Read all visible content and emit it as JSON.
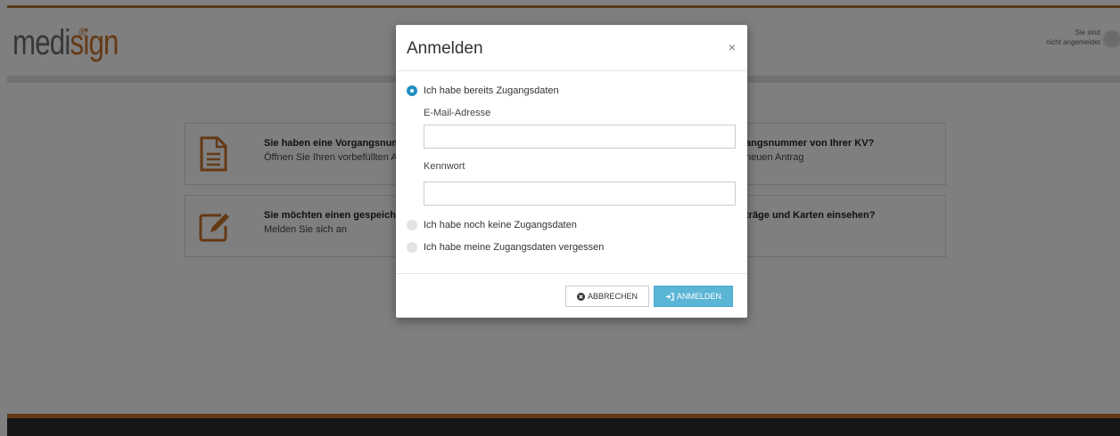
{
  "header": {
    "logo_part1": "medi",
    "logo_part2": "sign",
    "logo_reg": "®",
    "status_line1": "Sie sind",
    "status_line2": "nicht angemeldet"
  },
  "cards": [
    {
      "title": "Sie haben eine Vorgangsnum",
      "subtitle": "Öffnen Sie Ihren vorbefüllten A",
      "icon": "document-icon"
    },
    {
      "title": "angsnummer von Ihrer KV?",
      "subtitle": "neuen Antrag"
    },
    {
      "title": "Sie möchten einen gespeiche",
      "subtitle": "Melden Sie sich an",
      "icon": "edit-icon"
    },
    {
      "title": "träge und Karten einsehen?",
      "subtitle": ""
    }
  ],
  "modal": {
    "title": "Anmelden",
    "close_icon": "×",
    "option_existing": "Ich habe bereits Zugangsdaten",
    "email_label": "E-Mail-Adresse",
    "email_value": "",
    "password_label": "Kennwort",
    "password_value": "",
    "option_new": "Ich habe noch keine Zugangsdaten",
    "option_forgot": "Ich habe meine Zugangsdaten vergessen",
    "cancel_label": "ABBRECHEN",
    "login_label": "ANMELDEN"
  },
  "colors": {
    "brand_orange": "#c8752b",
    "primary_blue": "#5bb6d6",
    "radio_blue": "#1f8fbf",
    "footer_dark": "#2d2d2d"
  }
}
